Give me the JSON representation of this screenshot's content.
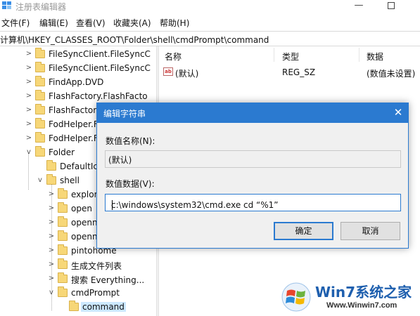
{
  "window": {
    "title": "注册表编辑器",
    "minimize_glyph": "—"
  },
  "menu": [
    "文件(F)",
    "编辑(E)",
    "查看(V)",
    "收藏夹(A)",
    "帮助(H)"
  ],
  "address": "计算机\\HKEY_CLASSES_ROOT\\Folder\\shell\\cmdPrompt\\command",
  "tree": {
    "items": [
      {
        "label": "FileSyncClient.FileSyncC",
        "expander": ">"
      },
      {
        "label": "FileSyncClient.FileSyncC",
        "expander": ">"
      },
      {
        "label": "FindApp.DVD",
        "expander": ">"
      },
      {
        "label": "FlashFactory.FlashFacto",
        "expander": ">"
      },
      {
        "label": "FlashFactory.Fl",
        "expander": ">"
      },
      {
        "label": "FodHelper.F",
        "expander": ">"
      },
      {
        "label": "FodHelper.F",
        "expander": ">"
      },
      {
        "label": "Folder",
        "expander": "v"
      },
      {
        "label": "DefaultIco",
        "expander": ""
      },
      {
        "label": "shell",
        "expander": "v"
      },
      {
        "label": "explor",
        "expander": ">"
      },
      {
        "label": "open",
        "expander": ">"
      },
      {
        "label": "openn",
        "expander": ">"
      },
      {
        "label": "openn",
        "expander": ">"
      },
      {
        "label": "pintohome",
        "expander": ">"
      },
      {
        "label": "生成文件列表",
        "expander": ">"
      },
      {
        "label": "搜索 Everything...",
        "expander": ">"
      },
      {
        "label": "cmdPrompt",
        "expander": "v"
      },
      {
        "label": "command",
        "expander": ""
      }
    ]
  },
  "list": {
    "columns": [
      "名称",
      "类型",
      "数据"
    ],
    "rows": [
      {
        "name": "(默认)",
        "type": "REG_SZ",
        "data": "(数值未设置)",
        "icon": "string-value-icon"
      }
    ],
    "icon_text": "ab"
  },
  "dialog": {
    "title": "编辑字符串",
    "close_glyph": "✕",
    "name_label": "数值名称(N):",
    "name_value": "(默认)",
    "data_label": "数值数据(V):",
    "data_value": "c:\\windows\\system32\\cmd.exe cd “%1”",
    "ok_label": "确定",
    "cancel_label": "取消",
    "accent_color": "#2b7ad0"
  },
  "watermark": {
    "brand_text": "Win7系统之家",
    "url": "Www.Winwin7.com"
  }
}
